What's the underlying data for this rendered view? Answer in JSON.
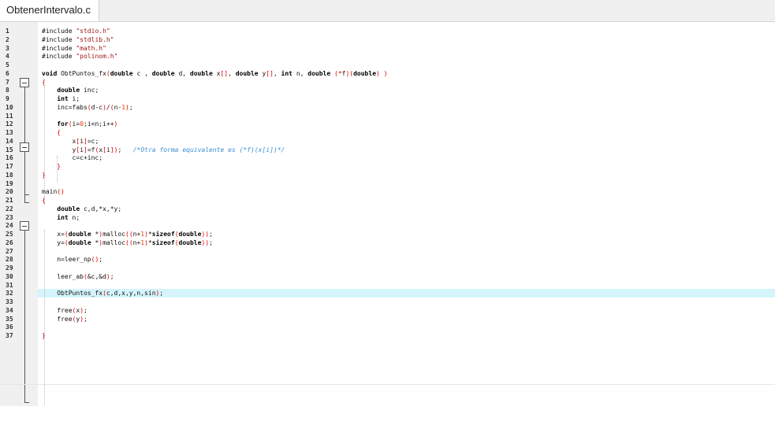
{
  "tab": {
    "filename": "ObtenerIntervalo.c"
  },
  "lines": [
    {
      "n": "1",
      "parts": [
        [
          "pp",
          "#include "
        ],
        [
          "str",
          "\"stdio.h\""
        ]
      ]
    },
    {
      "n": "2",
      "parts": [
        [
          "pp",
          "#include "
        ],
        [
          "str",
          "\"stdlib.h\""
        ]
      ]
    },
    {
      "n": "3",
      "parts": [
        [
          "pp",
          "#include "
        ],
        [
          "str",
          "\"math.h\""
        ]
      ]
    },
    {
      "n": "4",
      "parts": [
        [
          "pp",
          "#include "
        ],
        [
          "str",
          "\"polinom.h\""
        ]
      ]
    },
    {
      "n": "5",
      "parts": []
    },
    {
      "n": "6",
      "parts": [
        [
          "kw",
          "void"
        ],
        [
          "t",
          " ObtPuntos_fx"
        ],
        [
          "op",
          "("
        ],
        [
          "kw",
          "double"
        ],
        [
          "t",
          " c , "
        ],
        [
          "kw",
          "double"
        ],
        [
          "t",
          " d, "
        ],
        [
          "kw",
          "double"
        ],
        [
          "t",
          " x"
        ],
        [
          "op",
          "[]"
        ],
        [
          "t",
          ", "
        ],
        [
          "kw",
          "double"
        ],
        [
          "t",
          " y"
        ],
        [
          "op",
          "[]"
        ],
        [
          "t",
          ", "
        ],
        [
          "kw",
          "int"
        ],
        [
          "t",
          " n, "
        ],
        [
          "kw",
          "double"
        ],
        [
          "t",
          " "
        ],
        [
          "op",
          "(*"
        ],
        [
          "t",
          "f"
        ],
        [
          "op",
          ")("
        ],
        [
          "kw",
          "double"
        ],
        [
          "op",
          ")"
        ],
        [
          "t",
          " "
        ],
        [
          "op",
          ")"
        ]
      ]
    },
    {
      "n": "7",
      "parts": [
        [
          "op",
          "{"
        ]
      ]
    },
    {
      "n": "8",
      "parts": [
        [
          "t",
          "    "
        ],
        [
          "kw",
          "double"
        ],
        [
          "t",
          " inc;"
        ]
      ]
    },
    {
      "n": "9",
      "parts": [
        [
          "t",
          "    "
        ],
        [
          "kw",
          "int"
        ],
        [
          "t",
          " i;"
        ]
      ]
    },
    {
      "n": "10",
      "parts": [
        [
          "t",
          "    inc=fabs"
        ],
        [
          "op",
          "("
        ],
        [
          "t",
          "d-c"
        ],
        [
          "op",
          ")"
        ],
        [
          "t",
          "/"
        ],
        [
          "op",
          "("
        ],
        [
          "t",
          "n-"
        ],
        [
          "num",
          "1"
        ],
        [
          "op",
          ")"
        ],
        [
          "t",
          ";"
        ]
      ]
    },
    {
      "n": "11",
      "parts": []
    },
    {
      "n": "12",
      "parts": [
        [
          "t",
          "    "
        ],
        [
          "kw",
          "for"
        ],
        [
          "op",
          "("
        ],
        [
          "t",
          "i="
        ],
        [
          "num",
          "0"
        ],
        [
          "t",
          ";i<n;i++"
        ],
        [
          "op",
          ")"
        ]
      ]
    },
    {
      "n": "13",
      "parts": [
        [
          "t",
          "    "
        ],
        [
          "op",
          "{"
        ]
      ]
    },
    {
      "n": "14",
      "parts": [
        [
          "t",
          "        x"
        ],
        [
          "op",
          "["
        ],
        [
          "t",
          "i"
        ],
        [
          "op",
          "]"
        ],
        [
          "t",
          "=c;"
        ]
      ]
    },
    {
      "n": "15",
      "parts": [
        [
          "t",
          "        y"
        ],
        [
          "op",
          "["
        ],
        [
          "t",
          "i"
        ],
        [
          "op",
          "]"
        ],
        [
          "t",
          "=f"
        ],
        [
          "op",
          "("
        ],
        [
          "t",
          "x"
        ],
        [
          "op",
          "["
        ],
        [
          "t",
          "i"
        ],
        [
          "op",
          "])"
        ],
        [
          "t",
          ";   "
        ],
        [
          "cm",
          "/*Otra forma equivalente es (*f)(x[i])*/"
        ]
      ]
    },
    {
      "n": "16",
      "parts": [
        [
          "t",
          "        c=c+inc;"
        ]
      ]
    },
    {
      "n": "17",
      "parts": [
        [
          "t",
          "    "
        ],
        [
          "op",
          "}"
        ]
      ]
    },
    {
      "n": "18",
      "parts": [
        [
          "op",
          "}"
        ]
      ]
    },
    {
      "n": "19",
      "parts": []
    },
    {
      "n": "20",
      "parts": [
        [
          "t",
          "main"
        ],
        [
          "op",
          "()"
        ]
      ]
    },
    {
      "n": "21",
      "parts": [
        [
          "op",
          "{"
        ]
      ]
    },
    {
      "n": "22",
      "parts": [
        [
          "t",
          "    "
        ],
        [
          "kw",
          "double"
        ],
        [
          "t",
          " c,d,*x,*y;"
        ]
      ]
    },
    {
      "n": "23",
      "parts": [
        [
          "t",
          "    "
        ],
        [
          "kw",
          "int"
        ],
        [
          "t",
          " n;"
        ]
      ]
    },
    {
      "n": "24",
      "parts": []
    },
    {
      "n": "25",
      "parts": [
        [
          "t",
          "    x="
        ],
        [
          "op",
          "("
        ],
        [
          "kw",
          "double"
        ],
        [
          "t",
          " *"
        ],
        [
          "op",
          ")"
        ],
        [
          "t",
          "malloc"
        ],
        [
          "op",
          "(("
        ],
        [
          "t",
          "n+"
        ],
        [
          "num",
          "1"
        ],
        [
          "op",
          ")"
        ],
        [
          "t",
          "*"
        ],
        [
          "kw",
          "sizeof"
        ],
        [
          "op",
          "("
        ],
        [
          "kw",
          "double"
        ],
        [
          "op",
          "))"
        ],
        [
          "t",
          ";"
        ]
      ]
    },
    {
      "n": "26",
      "parts": [
        [
          "t",
          "    y="
        ],
        [
          "op",
          "("
        ],
        [
          "kw",
          "double"
        ],
        [
          "t",
          " *"
        ],
        [
          "op",
          ")"
        ],
        [
          "t",
          "malloc"
        ],
        [
          "op",
          "(("
        ],
        [
          "t",
          "n+"
        ],
        [
          "num",
          "1"
        ],
        [
          "op",
          ")"
        ],
        [
          "t",
          "*"
        ],
        [
          "kw",
          "sizeof"
        ],
        [
          "op",
          "("
        ],
        [
          "kw",
          "double"
        ],
        [
          "op",
          "))"
        ],
        [
          "t",
          ";"
        ]
      ]
    },
    {
      "n": "27",
      "parts": []
    },
    {
      "n": "28",
      "parts": [
        [
          "t",
          "    n=leer_np"
        ],
        [
          "op",
          "()"
        ],
        [
          "t",
          ";"
        ]
      ]
    },
    {
      "n": "29",
      "parts": []
    },
    {
      "n": "30",
      "parts": [
        [
          "t",
          "    leer_ab"
        ],
        [
          "op",
          "("
        ],
        [
          "t",
          "&c,&d"
        ],
        [
          "op",
          ")"
        ],
        [
          "t",
          ";"
        ]
      ]
    },
    {
      "n": "31",
      "parts": []
    },
    {
      "n": "32",
      "parts": [
        [
          "t",
          "    ObtPuntos_fx"
        ],
        [
          "op",
          "("
        ],
        [
          "t",
          "c,d,x,y,n,sin"
        ],
        [
          "op",
          ")"
        ],
        [
          "t",
          ";"
        ]
      ]
    },
    {
      "n": "33",
      "parts": []
    },
    {
      "n": "34",
      "parts": [
        [
          "t",
          "    free"
        ],
        [
          "op",
          "("
        ],
        [
          "t",
          "x"
        ],
        [
          "op",
          ")"
        ],
        [
          "t",
          ";"
        ]
      ]
    },
    {
      "n": "35",
      "parts": [
        [
          "t",
          "    free"
        ],
        [
          "op",
          "("
        ],
        [
          "t",
          "y"
        ],
        [
          "op",
          ")"
        ],
        [
          "t",
          ";"
        ]
      ]
    },
    {
      "n": "36",
      "parts": []
    },
    {
      "n": "37",
      "parts": [
        [
          "op",
          "}"
        ]
      ]
    }
  ],
  "highlighted_line": "32",
  "colors": {
    "keyword": "#000000",
    "string": "#a31515",
    "number": "#e63d00",
    "operator": "#e00000",
    "comment": "#3a8fd8",
    "current_line": "#d5f4fb",
    "gutter": "#f0f0f0"
  }
}
